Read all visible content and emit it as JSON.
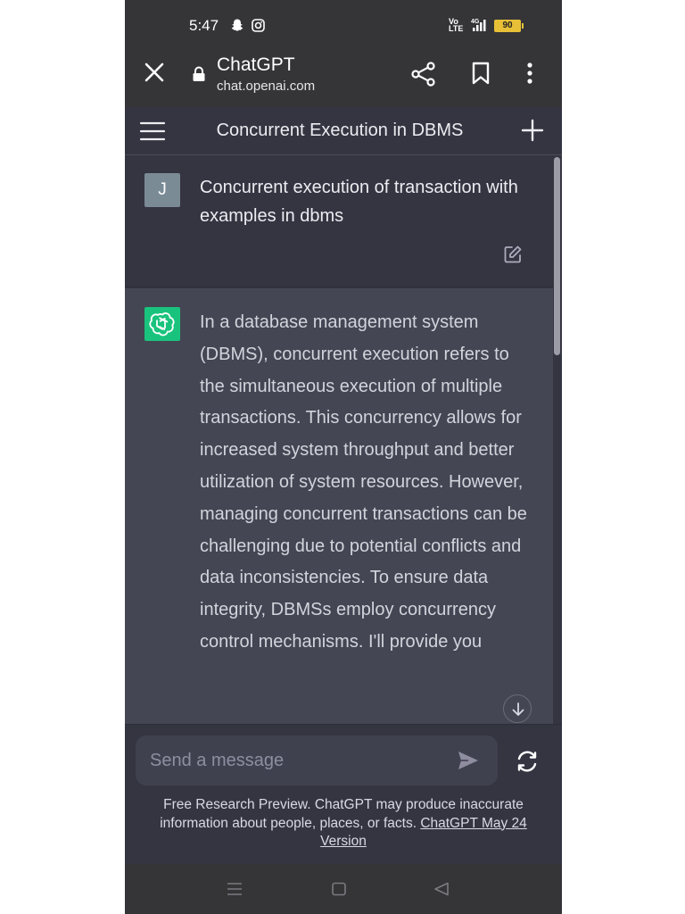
{
  "status_bar": {
    "time": "5:47",
    "net_label": "Vo LTE",
    "signal_label": "4G",
    "battery": "90"
  },
  "browser": {
    "site_title": "ChatGPT",
    "url": "chat.openai.com"
  },
  "chat": {
    "title": "Concurrent Execution in DBMS",
    "user": {
      "avatar_letter": "J",
      "message": "Concurrent execution of transaction with examples in dbms"
    },
    "assistant": {
      "message": "In a database management system (DBMS), concurrent execution refers to the simultaneous execution of multiple transactions. This concurrency allows for increased system throughput and better utilization of system resources. However, managing concurrent transactions can be challenging due to potential conflicts and data inconsistencies. To ensure data integrity, DBMSs employ concurrency control mechanisms. I'll provide you"
    }
  },
  "composer": {
    "placeholder": "Send a message",
    "footer_text": "Free Research Preview. ChatGPT may produce inaccurate information about people, places, or facts. ",
    "footer_link": "ChatGPT May 24 Version"
  },
  "colors": {
    "background": "#343541",
    "assistant_bg": "#444654",
    "assistant_avatar": "#19c37d",
    "battery": "#e8c037"
  },
  "icons": [
    "close-icon",
    "lock-icon",
    "share-icon",
    "bookmark-icon",
    "more-vert-icon",
    "menu-icon",
    "plus-icon",
    "edit-icon",
    "openai-logo-icon",
    "arrow-down-icon",
    "send-icon",
    "refresh-icon"
  ]
}
